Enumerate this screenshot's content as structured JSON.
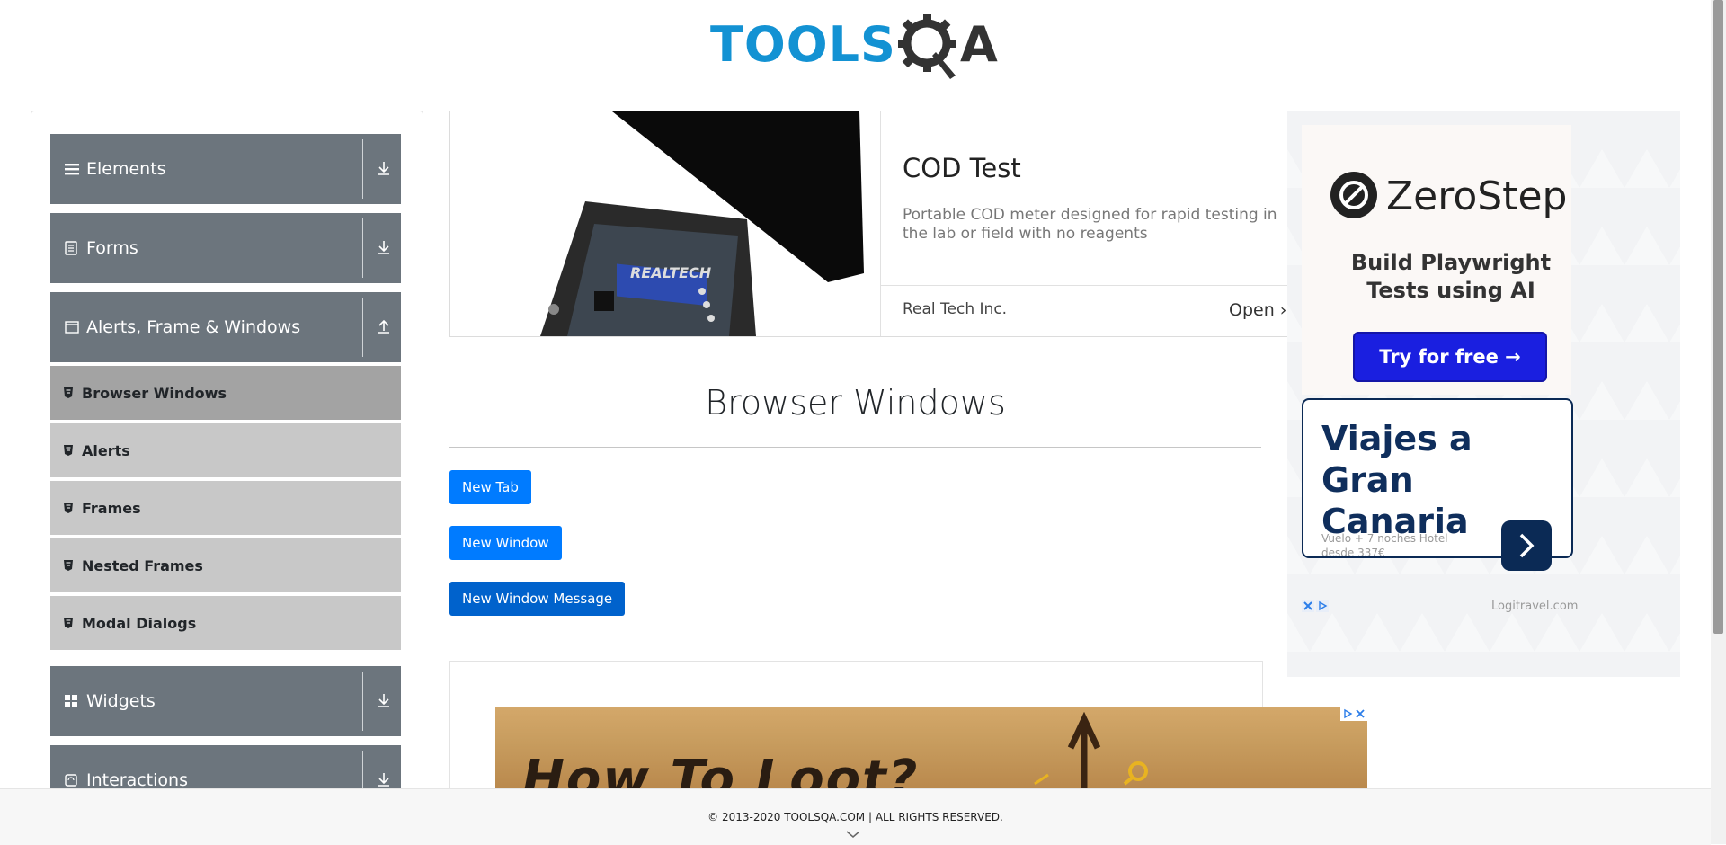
{
  "header": {
    "logo_text_a": "TOOLS",
    "logo_text_b": "A"
  },
  "sidebar": {
    "groups": [
      {
        "label": "Elements",
        "icon": "hamburger-icon",
        "expanded": false
      },
      {
        "label": "Forms",
        "icon": "document-icon",
        "expanded": false
      },
      {
        "label": "Alerts, Frame & Windows",
        "icon": "window-icon",
        "expanded": true
      },
      {
        "label": "Widgets",
        "icon": "widgets-icon",
        "expanded": false
      },
      {
        "label": "Interactions",
        "icon": "interactions-icon",
        "expanded": false
      }
    ],
    "items": [
      {
        "label": "Browser Windows",
        "active": true
      },
      {
        "label": "Alerts",
        "active": false
      },
      {
        "label": "Frames",
        "active": false
      },
      {
        "label": "Nested Frames",
        "active": false
      },
      {
        "label": "Modal Dialogs",
        "active": false
      }
    ]
  },
  "top_ad": {
    "title": "COD Test",
    "description": "Portable COD meter designed for rapid testing in the lab or field with no reagents",
    "brand": "Real Tech Inc.",
    "cta": "Open",
    "device_label": "REALTECH"
  },
  "main": {
    "title": "Browser Windows",
    "buttons": {
      "new_tab": "New Tab",
      "new_window": "New Window",
      "new_window_message": "New Window Message"
    }
  },
  "bottom_ad": {
    "text": "How To Loot?"
  },
  "side_ad": {
    "zerostep": {
      "name": "ZeroStep",
      "headline": "Build Playwright Tests using AI",
      "cta": "Try for free →"
    },
    "viajes": {
      "title": "Viajes a Gran Canaria",
      "subtitle": "Vuelo + 7 noches Hotel desde 337€",
      "brand": "Logitravel.com"
    }
  },
  "footer": {
    "text": "© 2013-2020 TOOLSQA.COM | ALL RIGHTS RESERVED."
  },
  "colors": {
    "sidebar_group": "#6c757d",
    "sidebar_item": "#c8c8c8",
    "sidebar_item_active": "#a3a3a3",
    "primary_button": "#007bff",
    "logo_blue": "#1392d3"
  }
}
